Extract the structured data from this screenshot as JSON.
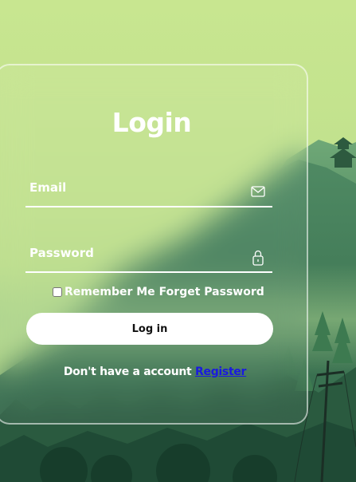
{
  "login": {
    "title": "Login",
    "email": {
      "placeholder": "Email",
      "icon": "mail-icon"
    },
    "password": {
      "placeholder": "Password",
      "icon": "lock-icon"
    },
    "remember_label": "Remember Me",
    "forgot_label": "Forget Password",
    "submit_label": "Log in",
    "register_prompt": "Don't have a account",
    "register_link": "Register"
  },
  "colors": {
    "sky": "#c6e58f",
    "forest_dark": "#2e5a3c",
    "button_bg": "#ffffff",
    "link": "#1a1adf"
  }
}
